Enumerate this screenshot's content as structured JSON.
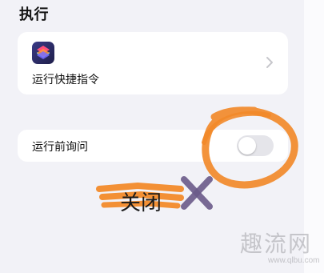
{
  "section": {
    "title": "执行"
  },
  "shortcut_card": {
    "icon": "shortcuts-app-icon",
    "label": "运行快捷指令",
    "chevron_icon": "chevron-right-icon"
  },
  "ask_before_running": {
    "label": "运行前询问",
    "toggle_state": "off"
  },
  "annotation": {
    "text": "关闭",
    "mark": "cross",
    "highlight_color": "#f28a2a",
    "cross_color": "#6b5b8a"
  },
  "watermark": {
    "main": "趣流网",
    "url": "www.qlbu.com"
  }
}
